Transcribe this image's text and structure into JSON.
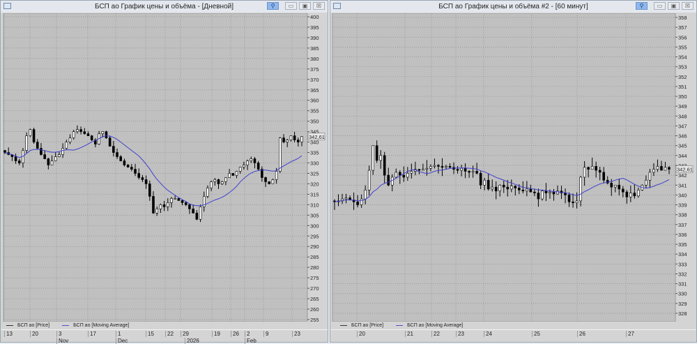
{
  "colors": {
    "plot_bg": "#c0c0c0",
    "grid": "#8c8c8c",
    "ma": "#4040d0",
    "up": "#ffffff",
    "down": "#000000"
  },
  "windows": [
    {
      "title": "БСП ао График цены и объёма - [Дневной]",
      "legend": {
        "price": "БСП ао [Price]",
        "ma": "БСП ао [Moving Average]"
      },
      "last_price_label": "342,61",
      "chart_data": {
        "type": "candlestick",
        "ylim": [
          255,
          400
        ],
        "yticks": [
          "400",
          "395",
          "390",
          "385",
          "380",
          "375",
          "370",
          "365",
          "360",
          "355",
          "350",
          "345",
          "340",
          "335",
          "330",
          "325",
          "320",
          "315",
          "310",
          "305",
          "300",
          "295",
          "290",
          "285",
          "280",
          "275",
          "270",
          "265",
          "260",
          "255"
        ],
        "date_labels": [
          "13",
          "20",
          "3",
          "17",
          "1",
          "15",
          "22",
          "29",
          "19",
          "26",
          "2",
          "9",
          "23"
        ],
        "month_labels": [
          "Nov",
          "Dec",
          "2026",
          "Feb"
        ],
        "closes": [
          335,
          334,
          333,
          331,
          330,
          336,
          343,
          346,
          340,
          337,
          334,
          332,
          329,
          331,
          333,
          334,
          337,
          340,
          342,
          345,
          346,
          345,
          344,
          343,
          341,
          339,
          344,
          345,
          342,
          338,
          335,
          333,
          331,
          329,
          328,
          327,
          325,
          323,
          322,
          320,
          314,
          306,
          308,
          310,
          309,
          311,
          313,
          313,
          312,
          311,
          310,
          308,
          306,
          303,
          309,
          314,
          318,
          321,
          322,
          320,
          321,
          323,
          325,
          324,
          326,
          328,
          329,
          331,
          332,
          330,
          327,
          323,
          321,
          320,
          322,
          326,
          342,
          340,
          341,
          343,
          341,
          340,
          342.61
        ],
        "ma_period": 12
      }
    },
    {
      "title": "БСП ао График цены и объёма #2 - [60 минут]",
      "legend": {
        "price": "БСП ао [Price]",
        "ma": "БСП ао [Moving Average]"
      },
      "last_price_label": "342,61",
      "chart_data": {
        "type": "candlestick",
        "ylim": [
          328,
          358
        ],
        "yticks": [
          "358",
          "357",
          "356",
          "355",
          "354",
          "353",
          "352",
          "351",
          "350",
          "349",
          "348",
          "347",
          "346",
          "345",
          "344",
          "343",
          "342",
          "341",
          "340",
          "339",
          "338",
          "337",
          "336",
          "335",
          "334",
          "333",
          "332",
          "331",
          "330",
          "329",
          "328"
        ],
        "date_labels": [
          "20",
          "21",
          "22",
          "23",
          "24",
          "25",
          "26",
          "27"
        ],
        "month_labels": [],
        "closes": [
          339.3,
          339.4,
          339.6,
          339.7,
          339.5,
          339.3,
          339.0,
          339.6,
          340.5,
          342.5,
          345.0,
          343.5,
          344.0,
          342.0,
          341.0,
          341.8,
          342.3,
          342.0,
          341.8,
          342.2,
          342.4,
          342.6,
          342.5,
          342.6,
          342.7,
          342.9,
          343.0,
          342.9,
          342.8,
          342.9,
          342.8,
          342.6,
          342.5,
          342.7,
          342.4,
          342.3,
          342.4,
          342.2,
          341.0,
          341.5,
          340.6,
          340.8,
          340.4,
          341.0,
          340.8,
          340.6,
          340.9,
          340.7,
          340.5,
          340.4,
          340.6,
          340.3,
          340.2,
          339.6,
          340.4,
          340.2,
          340.3,
          340.1,
          340.4,
          340.2,
          340.0,
          339.3,
          339.2,
          339.4,
          341.8,
          342.8,
          342.6,
          342.9,
          342.5,
          342.3,
          341.5,
          341.2,
          340.8,
          341.0,
          340.6,
          340.3,
          339.8,
          340.2,
          339.9,
          340.5,
          341.0,
          341.5,
          342.3,
          342.6,
          342.9,
          342.5,
          342.8,
          342.61
        ],
        "ma_period": 12
      }
    }
  ]
}
